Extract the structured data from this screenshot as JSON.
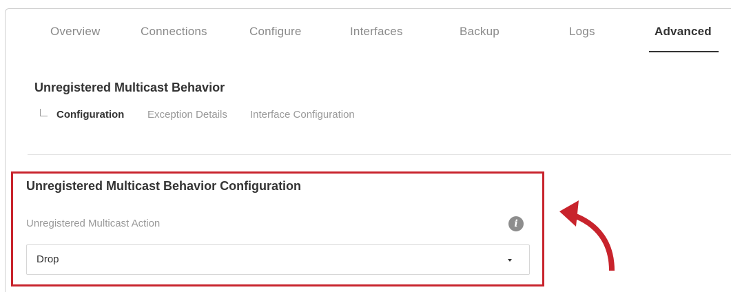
{
  "tabs": [
    {
      "label": "Overview"
    },
    {
      "label": "Connections"
    },
    {
      "label": "Configure"
    },
    {
      "label": "Interfaces"
    },
    {
      "label": "Backup"
    },
    {
      "label": "Logs"
    },
    {
      "label": "Advanced",
      "active": true
    }
  ],
  "section": {
    "title": "Unregistered Multicast Behavior",
    "subnav": [
      {
        "label": "Configuration",
        "active": true
      },
      {
        "label": "Exception Details"
      },
      {
        "label": "Interface Configuration"
      }
    ]
  },
  "card": {
    "title": "Unregistered Multicast Behavior Configuration",
    "field_label": "Unregistered Multicast Action",
    "info_icon": "info-icon",
    "select_value": "Drop",
    "caret_icon": "caret-down-icon"
  },
  "colors": {
    "highlight": "#c8232c",
    "arrow": "#c8232c",
    "active_text": "#333333",
    "inactive_text": "#8a8a8a"
  }
}
